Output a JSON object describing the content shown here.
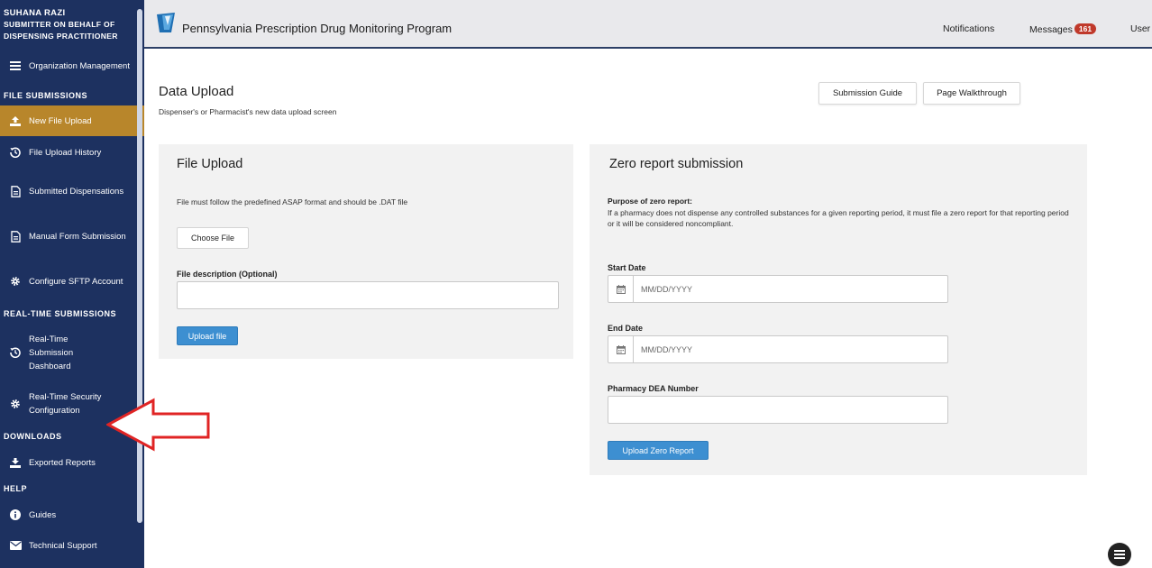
{
  "sidebar": {
    "user_name": "SUHANA RAZI",
    "user_role": "SUBMITTER ON BEHALF OF DISPENSING PRACTITIONER",
    "org_item": {
      "label": "Organization Management",
      "icon": "list-icon"
    },
    "sections": {
      "file_submissions": "FILE SUBMISSIONS",
      "realtime": "REAL-TIME SUBMISSIONS",
      "downloads": "DOWNLOADS",
      "help": "HELP"
    },
    "items": {
      "new_file_upload": "New File Upload",
      "file_upload_history": "File Upload History",
      "submitted_dispensations": "Submitted Dispensations",
      "manual_form": "Manual Form Submission",
      "configure_sftp": "Configure SFTP Account",
      "realtime_dashboard": "Real-Time Submission Dashboard",
      "realtime_security": "Real-Time Security Configuration",
      "exported_reports": "Exported Reports",
      "guides": "Guides",
      "technical_support": "Technical Support"
    },
    "active_color": "#b8862b",
    "bg_color": "#1d3160"
  },
  "header": {
    "title": "Pennsylvania Prescription Drug Monitoring Program",
    "notifications": "Notifications",
    "messages": "Messages",
    "messages_count": "161",
    "user": "User"
  },
  "page": {
    "title": "Data Upload",
    "subtitle": "Dispenser's or Pharmacist's new data upload screen",
    "submission_guide": "Submission Guide",
    "page_walkthrough": "Page Walkthrough"
  },
  "file_upload": {
    "title": "File Upload",
    "instruction": "File must follow the predefined ASAP format and should be .DAT file",
    "choose_file": "Choose File",
    "description_label": "File description (Optional)",
    "description_value": "",
    "upload_button": "Upload file"
  },
  "zero_report": {
    "title": "Zero report submission",
    "purpose_label": "Purpose of zero report:",
    "purpose_text": "If a pharmacy does not dispense any controlled substances for a given reporting period, it must file a zero report for that reporting period or it will be considered noncompliant.",
    "start_date_label": "Start Date",
    "start_date_placeholder": "MM/DD/YYYY",
    "end_date_label": "End Date",
    "end_date_placeholder": "MM/DD/YYYY",
    "dea_label": "Pharmacy DEA Number",
    "dea_value": "",
    "upload_button": "Upload Zero Report"
  },
  "accent_color": "#3d8fd1",
  "annotation_arrow_color": "#e02424"
}
